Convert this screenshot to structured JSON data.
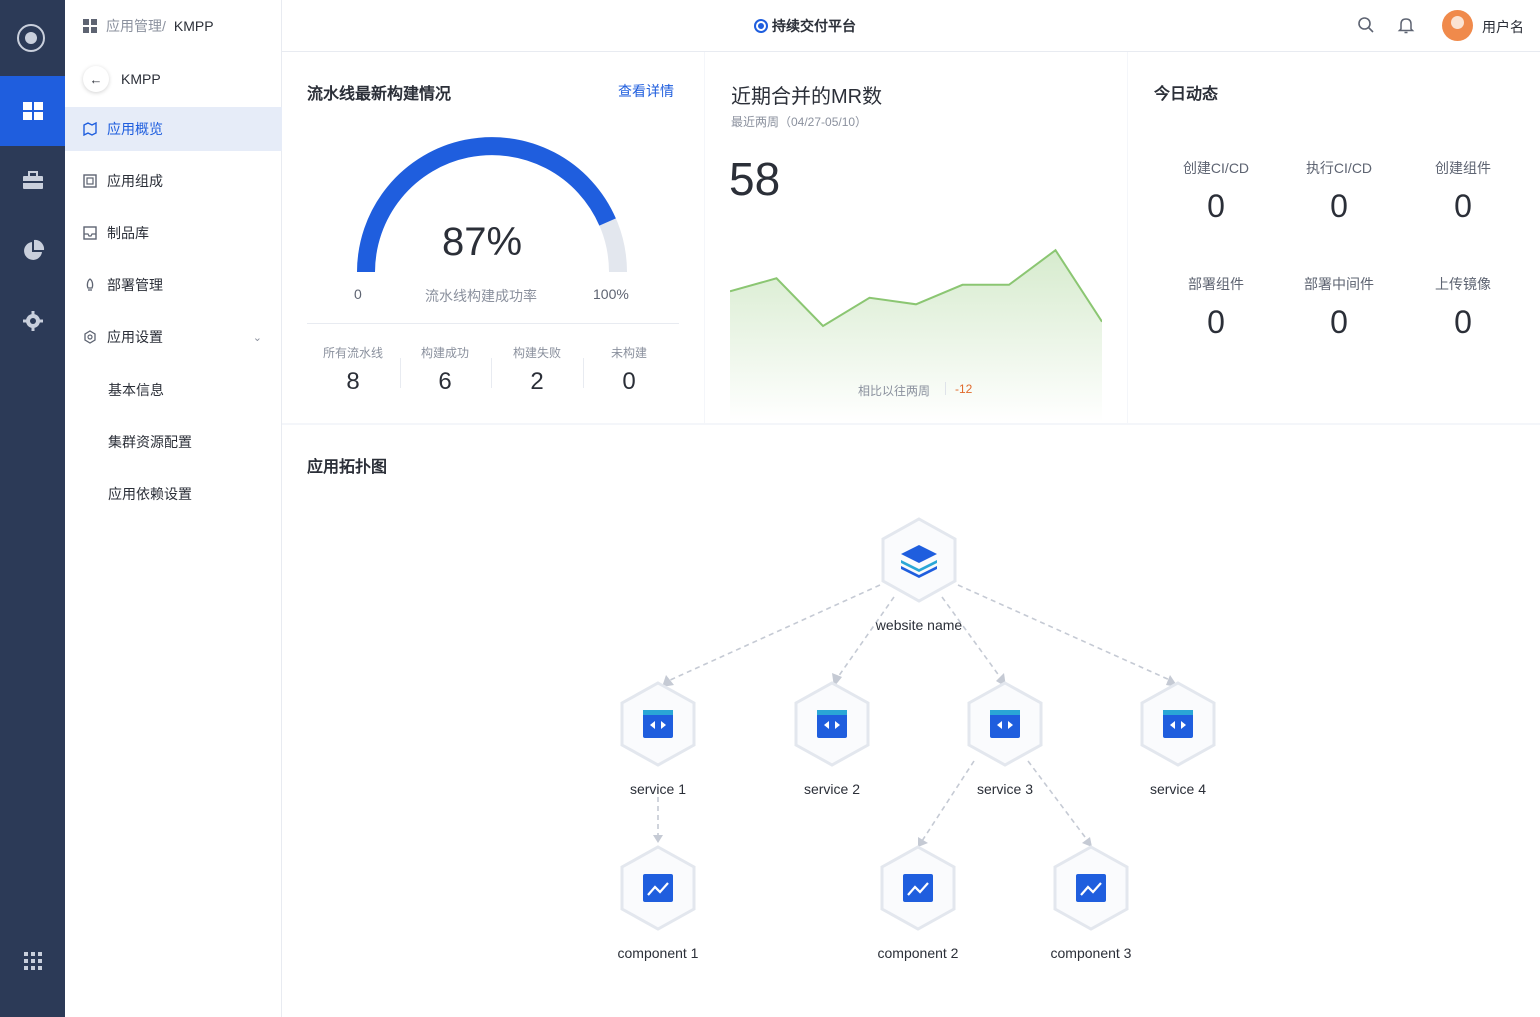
{
  "breadcrumb": {
    "parent": "应用管理/",
    "current": "KMPP"
  },
  "platform_title": "持续交付平台",
  "username": "用户名",
  "back_label": "KMPP",
  "nav": {
    "items": [
      {
        "label": "应用概览"
      },
      {
        "label": "应用组成"
      },
      {
        "label": "制品库"
      },
      {
        "label": "部署管理"
      },
      {
        "label": "应用设置"
      }
    ],
    "sub_items": [
      "基本信息",
      "集群资源配置",
      "应用依赖设置"
    ]
  },
  "pipeline": {
    "title": "流水线最新构建情况",
    "link": "查看详情",
    "percent_text": "87%",
    "percent_value": 0.87,
    "gauge_min": "0",
    "gauge_max": "100%",
    "gauge_caption": "流水线构建成功率",
    "stats": [
      {
        "label": "所有流水线",
        "value": "8"
      },
      {
        "label": "构建成功",
        "value": "6"
      },
      {
        "label": "构建失败",
        "value": "2"
      },
      {
        "label": "未构建",
        "value": "0"
      }
    ]
  },
  "mr": {
    "title": "近期合并的MR数",
    "subtitle": "最近两周（04/27-05/10）",
    "value": "58",
    "compare_label": "相比以往两周",
    "compare_value": "-12",
    "chart_data": {
      "type": "area",
      "values": [
        28,
        34,
        12,
        25,
        22,
        31,
        31,
        47,
        14
      ],
      "ylim": [
        0,
        60
      ],
      "color": "#8bc672"
    }
  },
  "today": {
    "title": "今日动态",
    "items": [
      {
        "label": "创建CI/CD",
        "value": "0"
      },
      {
        "label": "执行CI/CD",
        "value": "0"
      },
      {
        "label": "创建组件",
        "value": "0"
      },
      {
        "label": "部署组件",
        "value": "0"
      },
      {
        "label": "部署中间件",
        "value": "0"
      },
      {
        "label": "上传镜像",
        "value": "0"
      }
    ]
  },
  "topology": {
    "title": "应用拓扑图",
    "root": "website name",
    "services": [
      "service 1",
      "service 2",
      "service 3",
      "service 4"
    ],
    "components": [
      "component 1",
      "component 2",
      "component 3"
    ]
  },
  "colors": {
    "primary": "#1f5ede",
    "rail": "#2c3a57",
    "gauge_track": "#e3e7ee",
    "line": "#8bc672"
  },
  "icons": {
    "rail": [
      "logo-icon",
      "dashboard-icon",
      "toolbox-icon",
      "pie-chart-icon",
      "gear-icon",
      "apps-grid-icon"
    ],
    "topbar": [
      "search-icon",
      "bell-icon"
    ]
  }
}
